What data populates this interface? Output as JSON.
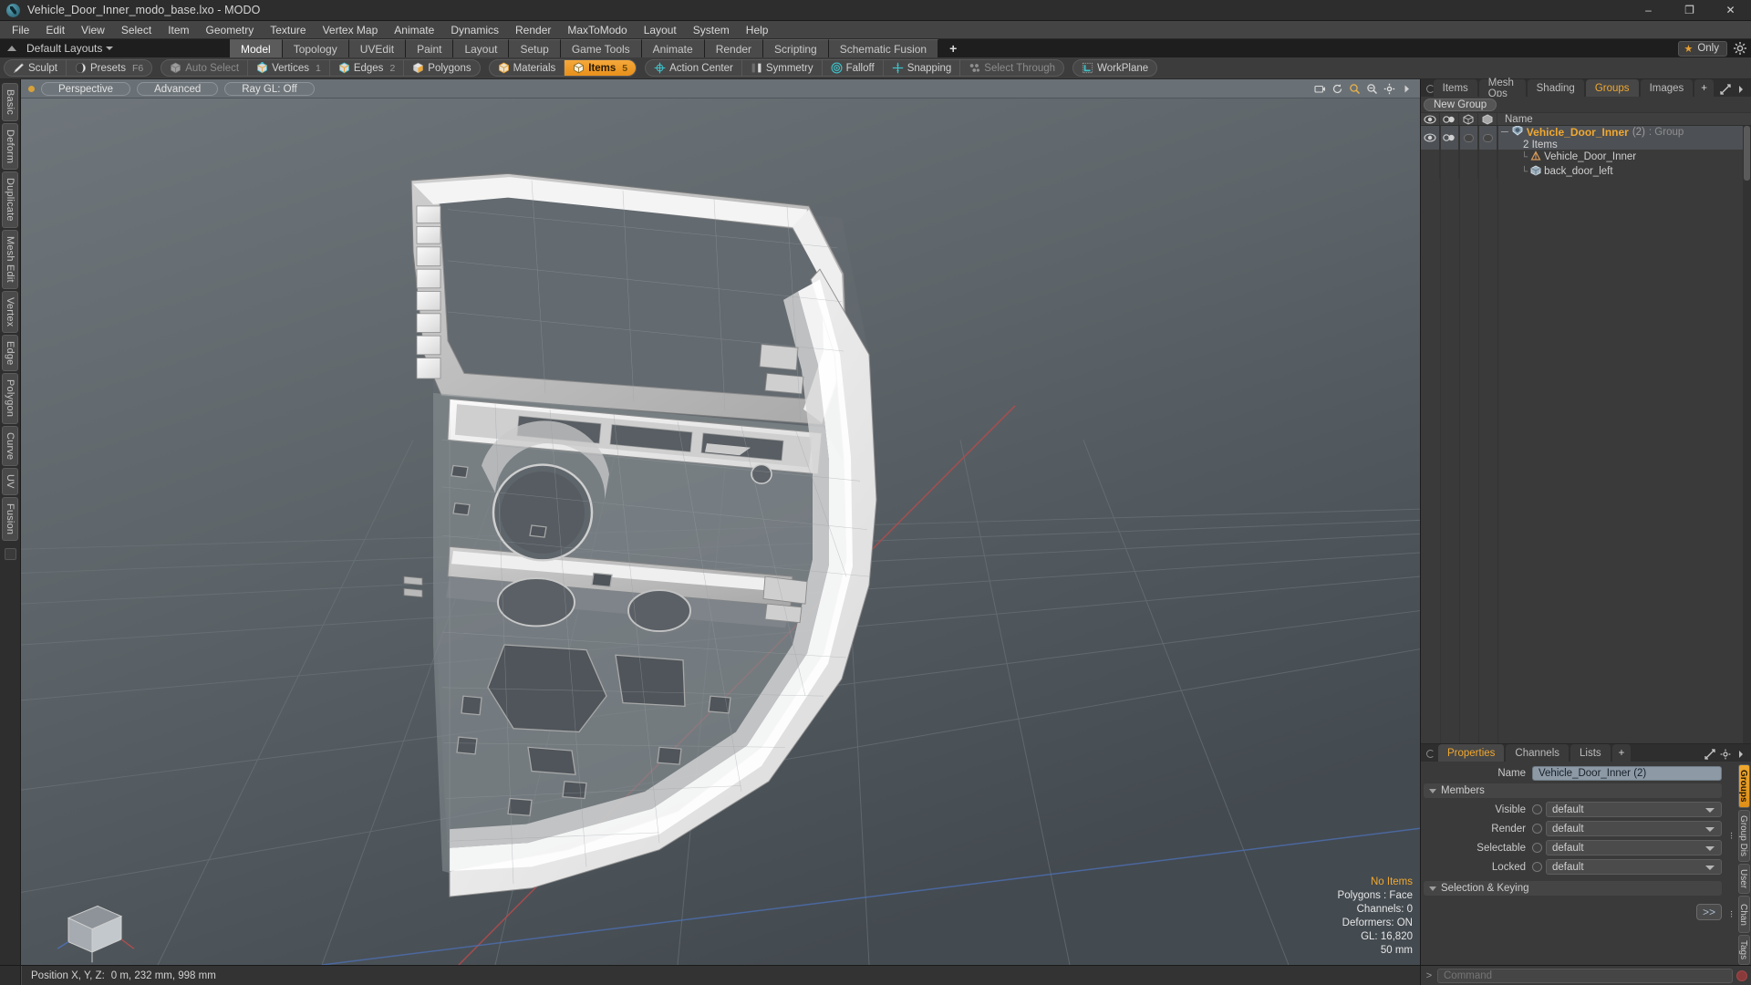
{
  "window": {
    "title": "Vehicle_Door_Inner_modo_base.lxo - MODO",
    "minimize": "–",
    "maximize": "❐",
    "close": "✕"
  },
  "menubar": {
    "items": [
      "File",
      "Edit",
      "View",
      "Select",
      "Item",
      "Geometry",
      "Texture",
      "Vertex Map",
      "Animate",
      "Dynamics",
      "Render",
      "MaxToModo",
      "Layout",
      "System",
      "Help"
    ]
  },
  "layoutrow": {
    "layout_label": "Default Layouts",
    "tabs": [
      {
        "label": "Model",
        "active": true
      },
      {
        "label": "Topology",
        "active": false
      },
      {
        "label": "UVEdit",
        "active": false
      },
      {
        "label": "Paint",
        "active": false
      },
      {
        "label": "Layout",
        "active": false
      },
      {
        "label": "Setup",
        "active": false
      },
      {
        "label": "Game Tools",
        "active": false
      },
      {
        "label": "Animate",
        "active": false
      },
      {
        "label": "Render",
        "active": false
      },
      {
        "label": "Scripting",
        "active": false
      },
      {
        "label": "Schematic Fusion",
        "active": false
      }
    ],
    "add_tab": "+",
    "only_label": "Only",
    "star_glyph": "★"
  },
  "modebar": {
    "groups": [
      {
        "items": [
          {
            "label": "Sculpt",
            "icon": "pencil-icon",
            "state": "normal",
            "num": ""
          },
          {
            "label": "Presets",
            "icon": "sphere-icon",
            "state": "normal",
            "num": "F6"
          }
        ]
      },
      {
        "items": [
          {
            "label": "Auto Select",
            "icon": "cube-grey-icon",
            "state": "disabled",
            "num": ""
          },
          {
            "label": "Vertices",
            "icon": "cube-vertex-icon",
            "state": "normal",
            "num": "1"
          },
          {
            "label": "Edges",
            "icon": "cube-edge-icon",
            "state": "normal",
            "num": "2"
          },
          {
            "label": "Polygons",
            "icon": "cube-polygon-icon",
            "state": "normal",
            "num": ""
          }
        ]
      },
      {
        "items": [
          {
            "label": "Materials",
            "icon": "cube-material-icon",
            "state": "normal",
            "num": ""
          },
          {
            "label": "Items",
            "icon": "cube-items-icon",
            "state": "active",
            "num": "5"
          }
        ]
      },
      {
        "items": [
          {
            "label": "Action Center",
            "icon": "crosshair-circle-icon",
            "state": "normal",
            "num": ""
          },
          {
            "label": "Symmetry",
            "icon": "symmetry-icon",
            "state": "normal",
            "num": ""
          },
          {
            "label": "Falloff",
            "icon": "falloff-target-icon",
            "state": "normal",
            "num": ""
          },
          {
            "label": "Snapping",
            "icon": "snapping-icon",
            "state": "normal",
            "num": ""
          },
          {
            "label": "Select Through",
            "icon": "select-through-icon",
            "state": "disabled",
            "num": ""
          }
        ]
      },
      {
        "items": [
          {
            "label": "WorkPlane",
            "icon": "workplane-icon",
            "state": "normal",
            "num": ""
          }
        ]
      }
    ]
  },
  "lefttabs": {
    "items": [
      "Basic",
      "Deform",
      "Duplicate",
      "Mesh Edit",
      "Vertex",
      "Edge",
      "Polygon",
      "Curve",
      "UV",
      "Fusion"
    ]
  },
  "viewport": {
    "dot_color": "#d8a13a",
    "buttons": [
      "Perspective",
      "Advanced",
      "Ray GL: Off"
    ],
    "icons": [
      "camera-icon",
      "refresh-icon",
      "search-icon",
      "zoom-icon",
      "gear-icon",
      "chevron-right-icon"
    ],
    "stats": {
      "selection": "No Items",
      "polygons": "Polygons : Face",
      "channels": "Channels: 0",
      "deformers": "Deformers: ON",
      "gl": "GL: 16,820",
      "scale": "50 mm"
    },
    "model_name": "back_door_left",
    "grid_color": "#6b7479",
    "axis_x_color": "#b14d4d",
    "axis_z_color": "#4d6fb1"
  },
  "rightpanel": {
    "tabs": [
      {
        "label": "Items",
        "active": false
      },
      {
        "label": "Mesh Ops",
        "active": false
      },
      {
        "label": "Shading",
        "active": false
      },
      {
        "label": "Groups",
        "active": true
      },
      {
        "label": "Images",
        "active": false
      }
    ],
    "add_tab": "+",
    "new_group_button": "New Group",
    "tree_header": {
      "col_visible": "eye-icon",
      "col_render": "render-icon",
      "col_wire": "wireframe-icon",
      "col_shade": "shaded-icon",
      "name": "Name"
    },
    "tree": {
      "group": {
        "name": "Vehicle_Door_Inner",
        "count": "(2)",
        "type": ": Group",
        "subtitle": "2 Items",
        "icon": "group-shield-icon"
      },
      "children": [
        {
          "name": "Vehicle_Door_Inner",
          "icon": "locator-icon"
        },
        {
          "name": "back_door_left",
          "icon": "mesh-cube-icon"
        }
      ]
    }
  },
  "properties": {
    "tabs": [
      {
        "label": "Properties",
        "active": true
      },
      {
        "label": "Channels",
        "active": false
      },
      {
        "label": "Lists",
        "active": false
      }
    ],
    "add_tab": "+",
    "name_label": "Name",
    "name_value": "Vehicle_Door_Inner (2)",
    "members_section": "Members",
    "fields": [
      {
        "label": "Visible",
        "value": "default"
      },
      {
        "label": "Render",
        "value": "default"
      },
      {
        "label": "Selectable",
        "value": "default"
      },
      {
        "label": "Locked",
        "value": "default"
      }
    ],
    "selection_section": "Selection & Keying",
    "expand_button": ">>",
    "side_tabs": [
      {
        "label": "Groups",
        "active": true
      },
      {
        "label": "Group Dis ...",
        "active": false
      },
      {
        "label": "User",
        "active": false
      },
      {
        "label": "Chan ...",
        "active": false
      },
      {
        "label": "Tags",
        "active": false
      }
    ]
  },
  "statusbar": {
    "position_label": "Position X, Y, Z:",
    "position_value": "0 m, 232 mm, 998 mm",
    "command_prompt": ">",
    "command_placeholder": "Command"
  }
}
